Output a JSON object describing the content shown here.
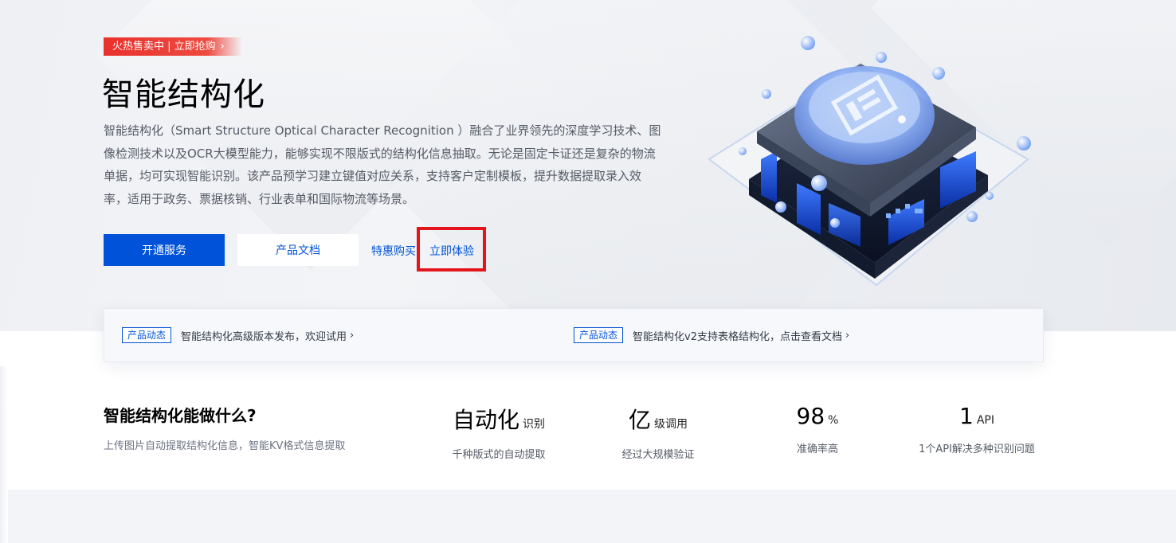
{
  "hero": {
    "promo": {
      "label": "火热售卖中 | 立即抢购",
      "chevron": "›"
    },
    "title": "智能结构化",
    "description": "智能结构化（Smart Structure Optical Character Recognition ）融合了业界领先的深度学习技术、图像检测技术以及OCR大模型能力，能够实现不限版式的结构化信息抽取。无论是固定卡证还是复杂的物流单据，均可实现智能识别。该产品预学习建立键值对应关系，支持客户定制模板，提升数据提取录入效率，适用于政务、票据核销、行业表单和国际物流等场景。",
    "buttons": {
      "primary": "开通服务",
      "secondary": "产品文档",
      "buy_link": "特惠购买",
      "try_link": "立即体验"
    }
  },
  "news": [
    {
      "badge": "产品动态",
      "text": "智能结构化高级版本发布，欢迎试用",
      "chevron": "›"
    },
    {
      "badge": "产品动态",
      "text": "智能结构化v2支持表格结构化，点击查看文档",
      "chevron": "›"
    }
  ],
  "features": {
    "title": "智能结构化能做什么?",
    "subtitle": "上传图片自动提取结构化信息，智能KV格式信息提取",
    "stats": [
      {
        "value": "自动化",
        "unit": "识别",
        "caption": "千种版式的自动提取"
      },
      {
        "value": "亿",
        "unit": "级调用",
        "caption": "经过大规模验证"
      },
      {
        "value": "98",
        "unit": "%",
        "caption": "准确率高"
      },
      {
        "value": "1",
        "unit": "API",
        "caption": "1个API解决多种识别问题"
      }
    ]
  },
  "colors": {
    "brand_blue": "#0052d9",
    "promo_red": "#e8312d",
    "highlight_red": "#e3141b"
  }
}
